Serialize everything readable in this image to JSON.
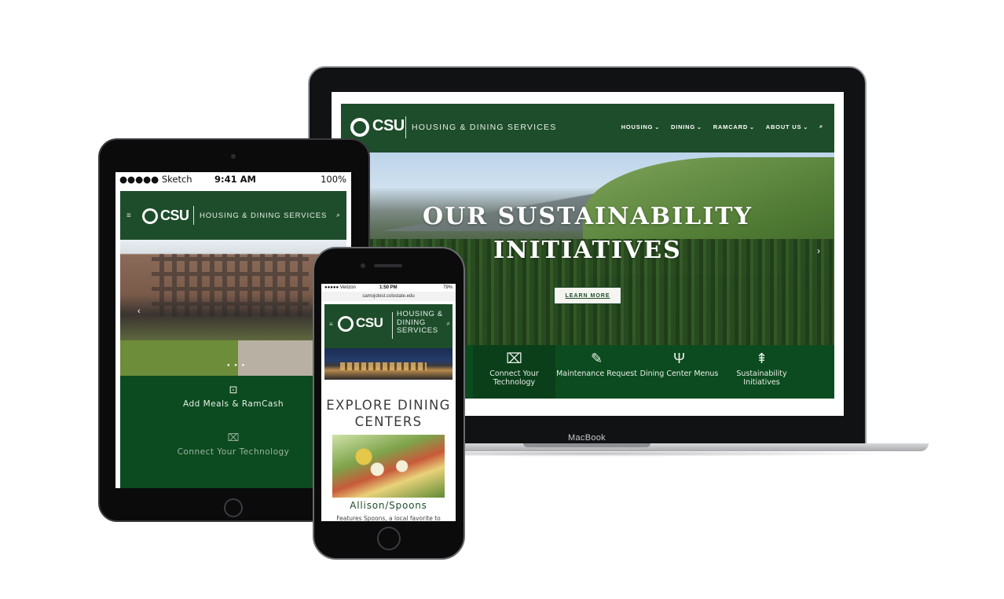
{
  "laptop": {
    "brand": "MacBook",
    "site": {
      "logo_text": "CSU",
      "subtitle": "HOUSING & DINING SERVICES",
      "nav": [
        {
          "label": "HOUSING"
        },
        {
          "label": "DINING"
        },
        {
          "label": "RAMCARD"
        },
        {
          "label": "ABOUT US"
        }
      ],
      "search_icon": "search-icon",
      "hero": {
        "title_line1": "OUR SUSTAINABILITY",
        "title_line2": "INITIATIVES",
        "cta": "LEARN MORE",
        "next_arrow": "›"
      },
      "quick_links": [
        {
          "label": "Connect Your Technology",
          "icon": "monitor-icon",
          "glyph": "⌧"
        },
        {
          "label": "Maintenance Request",
          "icon": "wrench-icon",
          "glyph": "✎"
        },
        {
          "label": "Dining Center Menus",
          "icon": "fork-knife-icon",
          "glyph": "Ψ"
        },
        {
          "label": "Sustainability Initiatives",
          "icon": "tree-icon",
          "glyph": "⇞"
        }
      ]
    }
  },
  "tablet": {
    "status": {
      "carrier": "●●●●● Sketch",
      "time": "9:41 AM",
      "battery": "100%"
    },
    "site": {
      "menu": "≡",
      "logo_text": "CSU",
      "subtitle": "HOUSING & DINING SERVICES",
      "search": "⌕",
      "hero_prev": "‹",
      "hero_dots": "● ● ●",
      "items": [
        {
          "label": "Add Meals & RamCash",
          "icon": "cash-icon",
          "glyph": "⊡"
        },
        {
          "label": "Connect Your Technology",
          "icon": "monitor-icon",
          "glyph": "⌧"
        }
      ]
    }
  },
  "phone": {
    "status": {
      "carrier": "●●●●● Verizon",
      "time": "1:50 PM",
      "battery": "79%"
    },
    "url": "samojotest.colostate.edu",
    "site": {
      "menu": "≡",
      "logo_text": "CSU",
      "subtitle": "HOUSING & DINING SERVICES",
      "search": "⌕",
      "title": "EXPLORE DINING CENTERS",
      "food_name": "Allison/Spoons",
      "food_desc": "Features Spoons, a local favorite to"
    }
  },
  "colors": {
    "csu_green": "#1e4d2b",
    "quicklink_green": "#0c4b1f"
  }
}
